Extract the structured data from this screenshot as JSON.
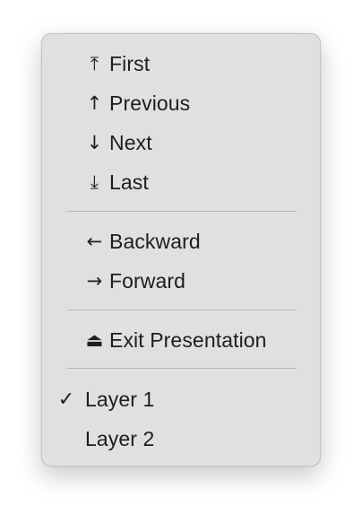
{
  "menu": {
    "navigation": [
      {
        "icon": "arrow-to-top-icon",
        "glyph": "⤒",
        "label": "First"
      },
      {
        "icon": "arrow-up-icon",
        "glyph": "↑",
        "label": "Previous"
      },
      {
        "icon": "arrow-down-icon",
        "glyph": "↓",
        "label": "Next"
      },
      {
        "icon": "arrow-to-bottom-icon",
        "glyph": "⤓",
        "label": "Last"
      }
    ],
    "direction": [
      {
        "icon": "arrow-left-icon",
        "glyph": "←",
        "label": "Backward"
      },
      {
        "icon": "arrow-right-icon",
        "glyph": "→",
        "label": "Forward"
      }
    ],
    "exit": {
      "icon": "eject-icon",
      "glyph": "⏏",
      "label": "Exit Presentation"
    },
    "layers": [
      {
        "label": "Layer 1",
        "checked": true,
        "check_glyph": "✓"
      },
      {
        "label": "Layer 2",
        "checked": false,
        "check_glyph": ""
      }
    ]
  }
}
